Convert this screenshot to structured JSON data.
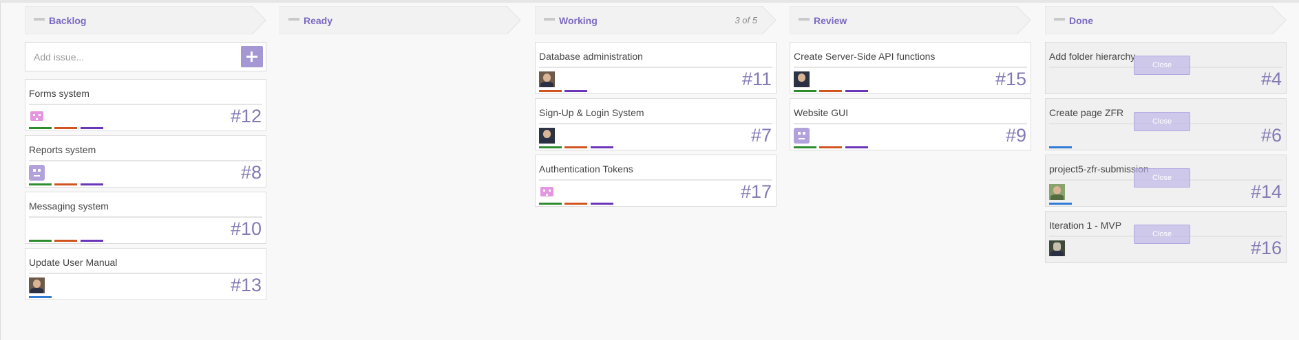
{
  "colors": {
    "accent": "#7b68c0",
    "issue_number": "#837ab5",
    "add_button": "#a597d4",
    "label_green": "#2e8b2e",
    "label_orange": "#d1541f",
    "label_purple": "#6a35b8",
    "label_blue": "#2f7bd6"
  },
  "columns": [
    {
      "title": "Backlog",
      "add_placeholder": "Add issue...",
      "cards": [
        {
          "title": "Forms system",
          "number": "#12",
          "avatar": "pink-pixel-avatar",
          "labels": [
            "#2e8b2e",
            "#d1541f",
            "#6a35b8"
          ]
        },
        {
          "title": "Reports system",
          "number": "#8",
          "avatar": "purple-pixel-avatar",
          "labels": [
            "#2e8b2e",
            "#d1541f",
            "#6a35b8"
          ]
        },
        {
          "title": "Messaging system",
          "number": "#10",
          "avatar": "",
          "labels": [
            "#2e8b2e",
            "#d1541f",
            "#6a35b8"
          ]
        },
        {
          "title": "Update User Manual",
          "number": "#13",
          "avatar": "photo-avatar",
          "labels": [
            "#2f7bd6"
          ]
        }
      ]
    },
    {
      "title": "Ready",
      "cards": []
    },
    {
      "title": "Working",
      "count": "3 of 5",
      "cards": [
        {
          "title": "Database administration",
          "number": "#11",
          "avatar": "photo-avatar",
          "labels": [
            "#d1541f",
            "#6a35b8"
          ]
        },
        {
          "title": "Sign-Up & Login System",
          "number": "#7",
          "avatar": "photo-avatar",
          "labels": [
            "#2e8b2e",
            "#d1541f",
            "#6a35b8"
          ]
        },
        {
          "title": "Authentication Tokens",
          "number": "#17",
          "avatar": "pink-pixel-avatar",
          "labels": [
            "#2e8b2e",
            "#d1541f",
            "#6a35b8"
          ]
        }
      ]
    },
    {
      "title": "Review",
      "cards": [
        {
          "title": "Create Server-Side API functions",
          "number": "#15",
          "avatar": "photo-avatar",
          "labels": [
            "#2e8b2e",
            "#d1541f",
            "#6a35b8"
          ]
        },
        {
          "title": "Website GUI",
          "number": "#9",
          "avatar": "purple-pixel-avatar",
          "labels": [
            "#2e8b2e",
            "#d1541f",
            "#6a35b8"
          ]
        }
      ]
    },
    {
      "title": "Done",
      "close_label": "Close",
      "cards": [
        {
          "title": "Add folder hierarchy",
          "number": "#4",
          "avatar": "",
          "labels": []
        },
        {
          "title": "Create page ZFR",
          "number": "#6",
          "avatar": "",
          "labels": [
            "#2f7bd6"
          ]
        },
        {
          "title": "project5-zfr-submission",
          "number": "#14",
          "avatar": "photo-avatar",
          "labels": [
            "#2f7bd6"
          ]
        },
        {
          "title": "Iteration 1 - MVP",
          "number": "#16",
          "avatar": "photo-avatar",
          "labels": []
        }
      ]
    }
  ]
}
